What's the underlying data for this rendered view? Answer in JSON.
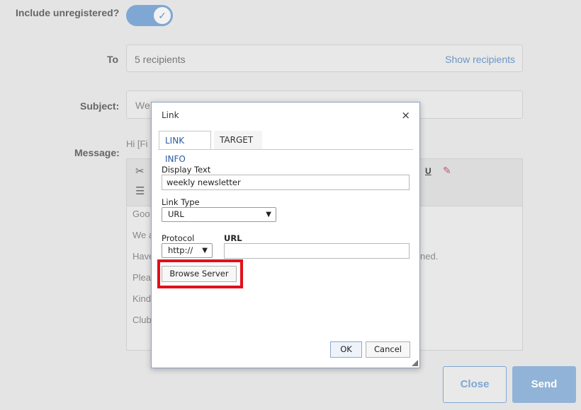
{
  "form": {
    "include_unregistered_label": "Include unregistered?",
    "include_unregistered_on": true,
    "to_label": "To",
    "to_value": "5 recipients",
    "show_recipients_link": "Show recipients",
    "subject_label": "Subject:",
    "subject_value_partial": "We",
    "message_label": "Message:",
    "greeting_partial": "Hi [Fi",
    "editor_lines": [
      "Goo",
      "We a",
      "Have",
      "Plea",
      "Kind",
      "Club"
    ],
    "editor_trailing_text": "ned.",
    "close_button": "Close",
    "send_button": "Send"
  },
  "dialog": {
    "title": "Link",
    "close_glyph": "×",
    "tabs": [
      {
        "label": "LINK INFO",
        "active": true
      },
      {
        "label": "TARGET",
        "active": false
      }
    ],
    "display_text_label": "Display Text",
    "display_text_value": "weekly newsletter",
    "link_type_label": "Link Type",
    "link_type_value": "URL",
    "protocol_label": "Protocol",
    "protocol_value": "http://",
    "url_label": "URL",
    "url_value": "",
    "browse_server_button": "Browse Server",
    "ok_button": "OK",
    "cancel_button": "Cancel"
  },
  "colors": {
    "accent": "#7ea7d3",
    "highlight": "#e1101c",
    "link": "#6d96c4"
  }
}
